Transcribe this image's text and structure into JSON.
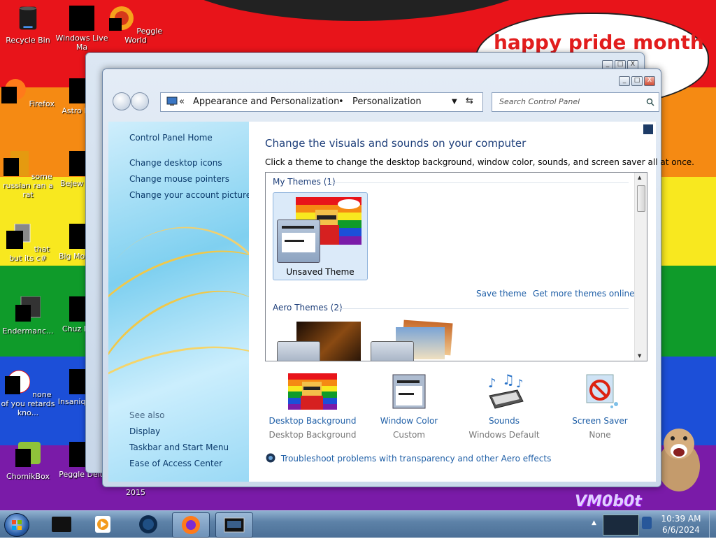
{
  "desktop": {
    "bubble_text": "happy pride month",
    "watermark": "VM0b0t",
    "icons": [
      {
        "label": "Recycle Bin",
        "icon": "recycle-bin-icon"
      },
      {
        "label": "Windows Live Ma",
        "icon": "windows-live-icon"
      },
      {
        "label": "Peggle World",
        "icon": "peggle-icon"
      },
      {
        "label": "Firefox",
        "icon": "firefox-icon"
      },
      {
        "label": "Astro Delu",
        "icon": "game-icon"
      },
      {
        "label": "some russian ran a rat",
        "icon": "game-icon"
      },
      {
        "label": "Bejew Delu",
        "icon": "game-icon"
      },
      {
        "label": "that but its c#",
        "icon": "file-icon"
      },
      {
        "label": "Big Mo Delu",
        "icon": "game-icon"
      },
      {
        "label": "Endermanc...",
        "icon": "app-icon"
      },
      {
        "label": "Chuz Delu",
        "icon": "game-icon"
      },
      {
        "label": "none of you retards kno...",
        "icon": "app-icon"
      },
      {
        "label": "Insaniq Delu",
        "icon": "game-icon"
      },
      {
        "label": "ChomikBox",
        "icon": "chomikbox-icon"
      },
      {
        "label": "Peggle Delu",
        "icon": "peggle-icon"
      },
      {
        "label": "2015",
        "icon": "file-icon"
      }
    ]
  },
  "window": {
    "address": {
      "chevron": "«",
      "crumb1": "Appearance and Personalization",
      "separator": "•",
      "crumb2": "Personalization"
    },
    "search_placeholder": "Search Control Panel",
    "caption": {
      "minimize": "_",
      "maximize": "□",
      "close": "X"
    },
    "side": {
      "home": "Control Panel Home",
      "links": [
        "Change desktop icons",
        "Change mouse pointers",
        "Change your account picture"
      ],
      "see_also": "See also",
      "see_also_links": [
        "Display",
        "Taskbar and Start Menu",
        "Ease of Access Center"
      ]
    },
    "main": {
      "heading": "Change the visuals and sounds on your computer",
      "subtext": "Click a theme to change the desktop background, window color, sounds, and screen saver all at once.",
      "my_themes": "My Themes (1)",
      "unsaved_theme": "Unsaved Theme",
      "save_theme": "Save theme",
      "get_more": "Get more themes online",
      "aero_themes": "Aero Themes (2)",
      "bottom": [
        {
          "title": "Desktop Background",
          "value": "Desktop Background"
        },
        {
          "title": "Window Color",
          "value": "Custom"
        },
        {
          "title": "Sounds",
          "value": "Windows Default"
        },
        {
          "title": "Screen Saver",
          "value": "None"
        }
      ],
      "troubleshoot": "Troubleshoot problems with transparency and other Aero effects"
    }
  },
  "taskbar": {
    "time": "10:39 AM",
    "date": "6/6/2024"
  }
}
